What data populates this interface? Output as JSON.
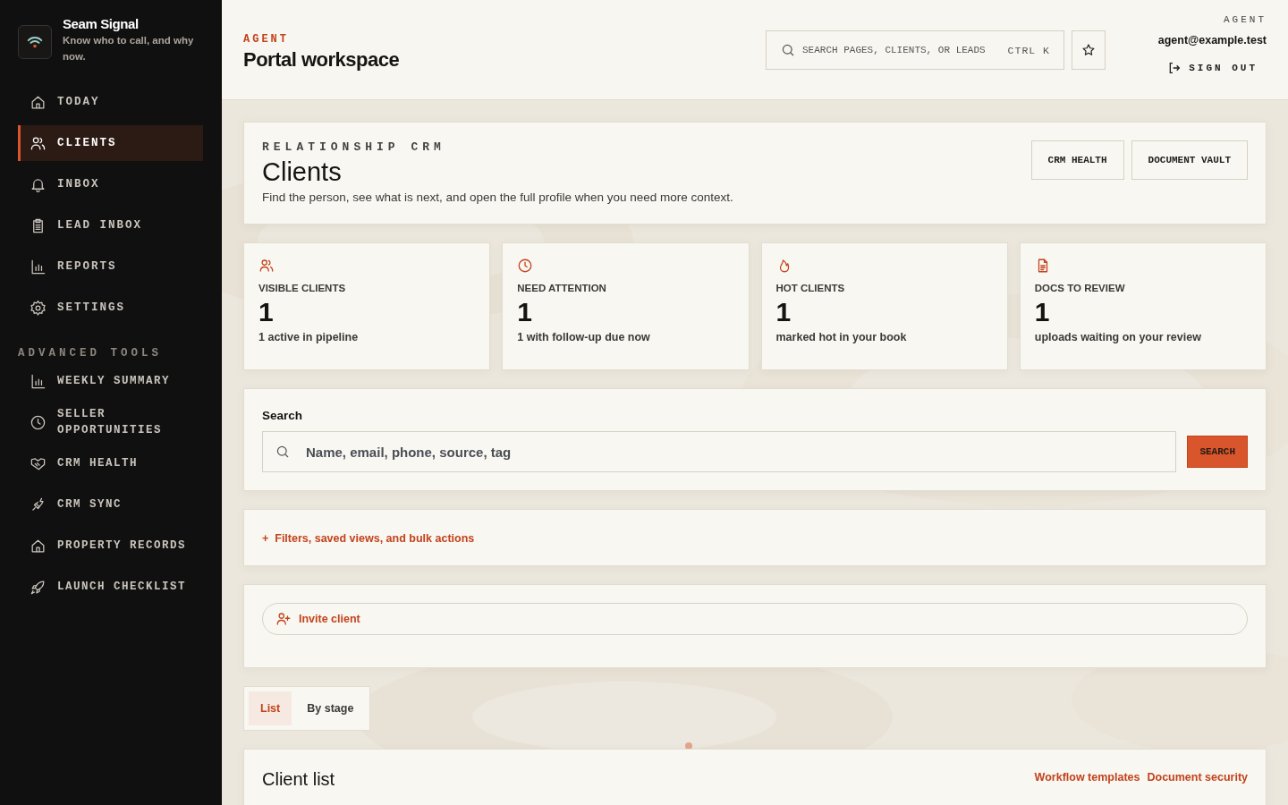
{
  "brand": {
    "name": "Seam Signal",
    "tagline": "Know who to call, and why now."
  },
  "nav": [
    {
      "label": "TODAY",
      "kind": "home",
      "selected": false
    },
    {
      "label": "CLIENTS",
      "kind": "users",
      "selected": true
    },
    {
      "label": "INBOX",
      "kind": "bell",
      "selected": false
    },
    {
      "label": "LEAD INBOX",
      "kind": "clipboard",
      "selected": false
    },
    {
      "label": "REPORTS",
      "kind": "chart",
      "selected": false
    },
    {
      "label": "SETTINGS",
      "kind": "gear",
      "selected": false
    }
  ],
  "advanced": {
    "heading": "ADVANCED TOOLS",
    "items": [
      {
        "label": "WEEKLY SUMMARY",
        "kind": "chart",
        "selected": false
      },
      {
        "label": "SELLER OPPORTUNITIES",
        "kind": "clock",
        "selected": false
      },
      {
        "label": "CRM HEALTH",
        "kind": "handshake",
        "selected": false
      },
      {
        "label": "CRM SYNC",
        "kind": "plug",
        "selected": false
      },
      {
        "label": "PROPERTY RECORDS",
        "kind": "home",
        "selected": false
      },
      {
        "label": "LAUNCH CHECKLIST",
        "kind": "rocket",
        "selected": false
      }
    ]
  },
  "header": {
    "eyebrow": "AGENT",
    "title": "Portal workspace",
    "search": {
      "placeholder": "SEARCH PAGES, CLIENTS, OR LEADS",
      "shortcut": "CTRL K"
    },
    "role": "AGENT",
    "email": "agent@example.test",
    "sign_out": "SIGN OUT"
  },
  "intro": {
    "eyebrow": "RELATIONSHIP CRM",
    "title": "Clients",
    "description": "Find the person, see what is next, and open the full profile when you need more context.",
    "buttons": [
      "CRM HEALTH",
      "DOCUMENT VAULT"
    ]
  },
  "stats": [
    {
      "kind": "users",
      "label": "VISIBLE CLIENTS",
      "value": "1",
      "note": "1 active in pipeline"
    },
    {
      "kind": "clock",
      "label": "NEED ATTENTION",
      "value": "1",
      "note": "1 with follow-up due now"
    },
    {
      "kind": "flame",
      "label": "HOT CLIENTS",
      "value": "1",
      "note": "marked hot in your book"
    },
    {
      "kind": "document",
      "label": "DOCS TO REVIEW",
      "value": "1",
      "note": "uploads waiting on your review"
    }
  ],
  "search": {
    "label": "Search",
    "placeholder": "Name, email, phone, source, tag",
    "button": "SEARCH"
  },
  "filters": {
    "mark": "+",
    "label": "Filters, saved views, and bulk actions"
  },
  "invite": {
    "label": "Invite client"
  },
  "view_tabs": [
    {
      "label": "List",
      "selected": true
    },
    {
      "label": "By stage",
      "selected": false
    }
  ],
  "client_list": {
    "title": "Client list",
    "links": [
      "Workflow templates",
      "Document security"
    ]
  }
}
